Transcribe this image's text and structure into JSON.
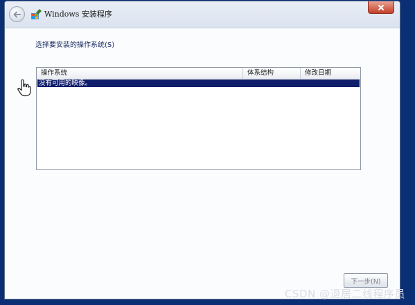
{
  "window": {
    "title": "Windows 安装程序"
  },
  "content": {
    "prompt": "选择要安装的操作系统(S)",
    "table": {
      "columns": [
        "操作系统",
        "体系结构",
        "修改日期"
      ],
      "rows": [
        {
          "text": "没有可用的映像。",
          "selected": true
        }
      ]
    },
    "next_button": "下一步(N)"
  },
  "watermark": "CSDN @退居二线程序员",
  "colors": {
    "desktop": "#0b2f74",
    "selection": "#0f1d6a"
  },
  "icons": [
    "back-arrow-icon",
    "setup-app-icon",
    "close-icon",
    "hand-cursor-icon"
  ]
}
